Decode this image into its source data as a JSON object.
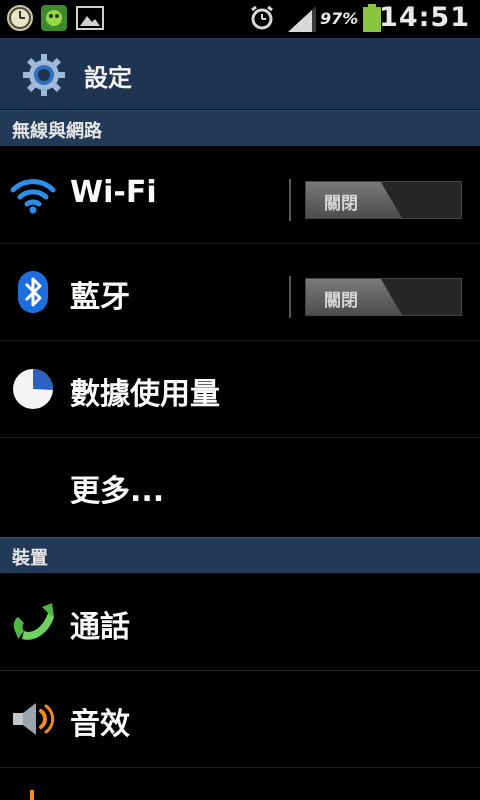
{
  "statusbar": {
    "left_icons": [
      "clock-app-icon",
      "game-notification-icon",
      "gallery-notification-icon"
    ],
    "right_icons": [
      "alarm-icon",
      "signal-icon",
      "battery-icon"
    ],
    "battery_percent": "97%",
    "battery_level": 0.97,
    "time": "14:51"
  },
  "actionbar": {
    "title": "設定",
    "icon": "settings-gear-icon"
  },
  "sections": [
    {
      "label": "無線與網路",
      "items": [
        {
          "label": "Wi-Fi",
          "icon": "wifi-icon",
          "toggle": "關閉",
          "toggle_on": false
        },
        {
          "label": "藍牙",
          "icon": "bluetooth-icon",
          "toggle": "關閉",
          "toggle_on": false
        },
        {
          "label": "數據使用量",
          "icon": "data-usage-pie-icon"
        },
        {
          "label": "更多..."
        }
      ]
    },
    {
      "label": "裝置",
      "items": [
        {
          "label": "通話",
          "icon": "phone-call-icon"
        },
        {
          "label": "音效",
          "icon": "speaker-sound-icon"
        }
      ]
    }
  ],
  "colors": {
    "background": "#000000",
    "actionbar": "#1e3450",
    "section_header": "#223a57",
    "wifi_blue": "#2c8ee8",
    "bluetooth_blue": "#1d6fe0",
    "phone_green": "#57c24a",
    "battery_green": "#8bc43e"
  }
}
